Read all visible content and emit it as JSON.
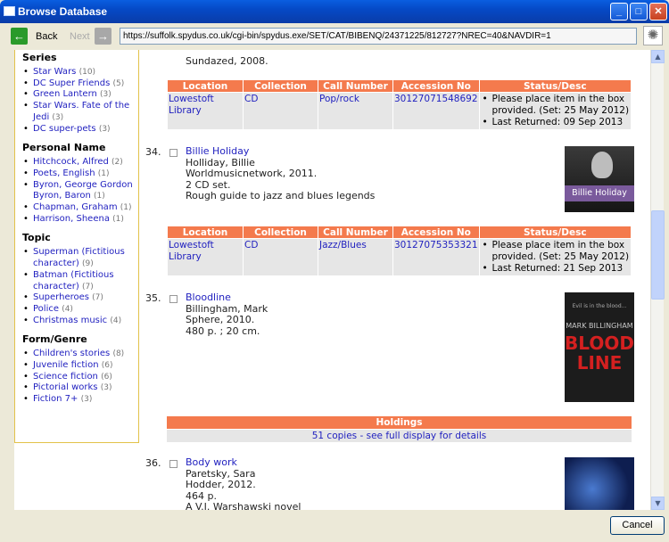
{
  "window": {
    "title": "Browse Database"
  },
  "toolbar": {
    "back_label": "Back",
    "next_label": "Next",
    "url": "https://suffolk.spydus.co.uk/cgi-bin/spydus.exe/SET/CAT/BIBENQ/24371225/812727?NREC=40&NAVDIR=1"
  },
  "sidebar": {
    "facets": [
      {
        "heading": "Series",
        "items": [
          {
            "label": "Star Wars",
            "count": "(10)"
          },
          {
            "label": "DC Super Friends",
            "count": "(5)"
          },
          {
            "label": "Green Lantern",
            "count": "(3)"
          },
          {
            "label": "Star Wars. Fate of the Jedi",
            "count": "(3)"
          },
          {
            "label": "DC super-pets",
            "count": "(3)"
          }
        ]
      },
      {
        "heading": "Personal Name",
        "items": [
          {
            "label": "Hitchcock, Alfred",
            "count": "(2)"
          },
          {
            "label": "Poets, English",
            "count": "(1)"
          },
          {
            "label": "Byron, George Gordon Byron, Baron",
            "count": "(1)"
          },
          {
            "label": "Chapman, Graham",
            "count": "(1)"
          },
          {
            "label": "Harrison, Sheena",
            "count": "(1)"
          }
        ]
      },
      {
        "heading": "Topic",
        "items": [
          {
            "label": "Superman (Fictitious character)",
            "count": "(9)"
          },
          {
            "label": "Batman (Fictitious character)",
            "count": "(7)"
          },
          {
            "label": "Superheroes",
            "count": "(7)"
          },
          {
            "label": "Police",
            "count": "(4)"
          },
          {
            "label": "Christmas music",
            "count": "(4)"
          }
        ]
      },
      {
        "heading": "Form/Genre",
        "items": [
          {
            "label": "Children's stories",
            "count": "(8)"
          },
          {
            "label": "Juvenile fiction",
            "count": "(6)"
          },
          {
            "label": "Science fiction",
            "count": "(6)"
          },
          {
            "label": "Pictorial works",
            "count": "(3)"
          },
          {
            "label": "Fiction 7+",
            "count": "(3)"
          }
        ]
      }
    ]
  },
  "results": {
    "prev_tail": "Sundazed, 2008.",
    "holdings_headers": [
      "Location",
      "Collection",
      "Call Number",
      "Accession No",
      "Status/Desc"
    ],
    "holdings_1": {
      "location": "Lowestoft Library",
      "collection": "CD",
      "call_number": "Pop/rock",
      "accession": "30127071548692",
      "status_1": "Please place item in the box provided. (Set: 25 May 2012)",
      "status_2": "Last Returned: 09 Sep 2013"
    },
    "rec34": {
      "number": "34.",
      "title": "Billie Holiday",
      "author": "Holliday, Billie",
      "publisher": "Worldmusicnetwork, 2011.",
      "extent": "2 CD set.",
      "note": "Rough guide to jazz and blues legends",
      "cover_text": "Billie Holiday"
    },
    "holdings_2": {
      "location": "Lowestoft Library",
      "collection": "CD",
      "call_number": "Jazz/Blues",
      "accession": "30127075353321",
      "status_1": "Please place item in the box provided. (Set: 25 May 2012)",
      "status_2": "Last Returned: 21 Sep 2013"
    },
    "rec35": {
      "number": "35.",
      "title": "Bloodline",
      "author": "Billingham, Mark",
      "publisher": "Sphere, 2010.",
      "extent": "480 p. ; 20 cm.",
      "cover_tag": "Evil is in the blood...",
      "cover_author": "MARK BILLINGHAM",
      "cover_title_1": "BLOOD",
      "cover_title_2": "LINE"
    },
    "holdings_summary": {
      "heading": "Holdings",
      "link": "51 copies - see full display for details"
    },
    "rec36": {
      "number": "36.",
      "title": "Body work",
      "author": "Paretsky, Sara",
      "publisher": "Hodder, 2012.",
      "extent": "464 p.",
      "note": "A V.I. Warshawski novel"
    }
  },
  "footer": {
    "cancel_label": "Cancel"
  },
  "colors": {
    "accent": "#f47a4d",
    "link": "#1f1fbf",
    "facet_border": "#e2c24a",
    "titlebar": "#0a5ee0"
  }
}
